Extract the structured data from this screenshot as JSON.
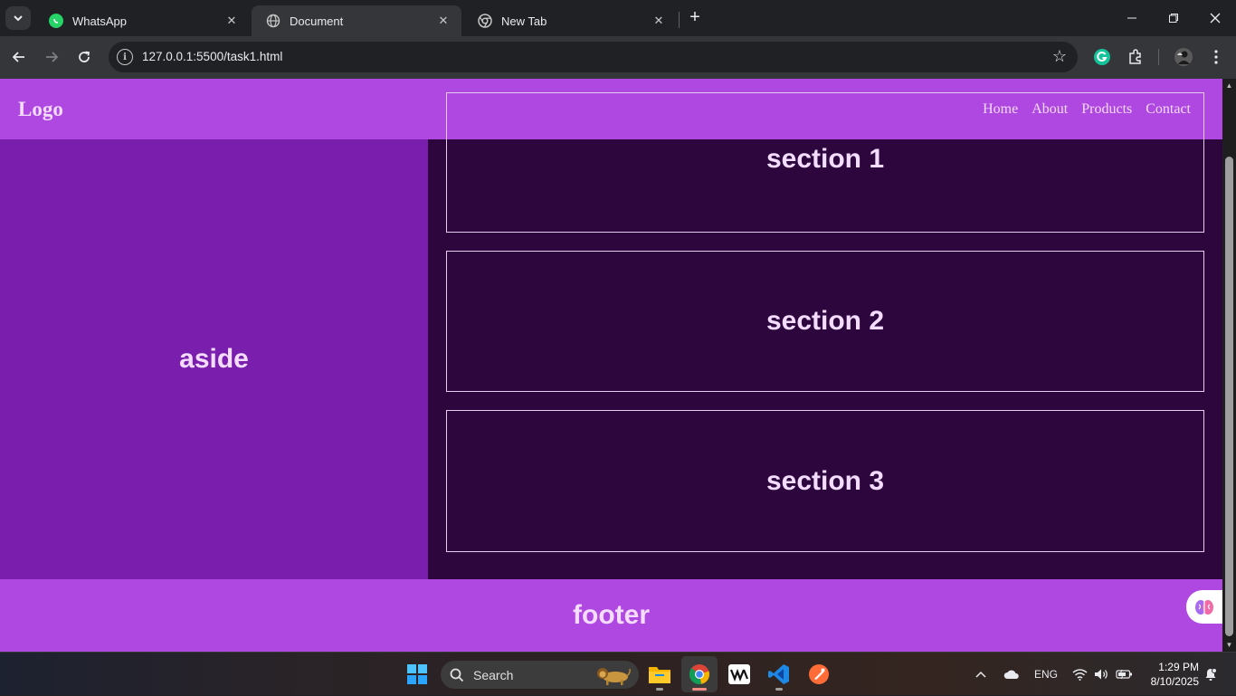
{
  "browser": {
    "tabs": [
      {
        "title": "WhatsApp",
        "icon": "whatsapp-icon",
        "active": false
      },
      {
        "title": "Document",
        "icon": "globe-icon",
        "active": true
      },
      {
        "title": "New Tab",
        "icon": "chrome-icon",
        "active": false
      }
    ],
    "url": "127.0.0.1:5500/task1.html"
  },
  "page": {
    "logo": "Logo",
    "nav": [
      "Home",
      "About",
      "Products",
      "Contact"
    ],
    "aside": "aside",
    "sections": [
      "section 1",
      "section 2",
      "section 3"
    ],
    "footer": "footer"
  },
  "taskbar": {
    "search_label": "Search",
    "language": "ENG",
    "time": "1:29 PM",
    "date": "8/10/2025"
  },
  "colors": {
    "header_footer": "#af47e1",
    "aside": "#7a1ead",
    "main": "#2c063d",
    "text": "#f4dcff"
  }
}
